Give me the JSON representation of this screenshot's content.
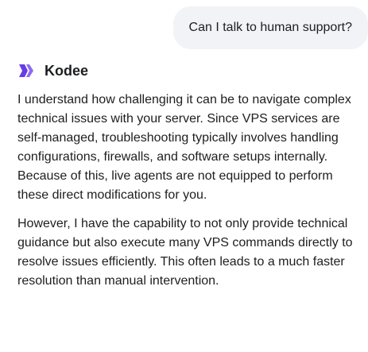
{
  "user_message": {
    "text": "Can I talk to human support?"
  },
  "assistant": {
    "name": "Kodee",
    "icon": "kodee-logo-icon",
    "brand_color": "#673de6",
    "paragraphs": [
      "I understand how challenging it can be to navigate complex technical issues with your server. Since VPS services are self-managed, troubleshooting typically involves handling configurations, firewalls, and software setups internally. Because of this, live agents are not equipped to perform these direct modifications for you.",
      "However, I have the capability to not only provide technical guidance but also execute many VPS commands directly to resolve issues efficiently. This often leads to a much faster resolution than manual intervention."
    ]
  },
  "colors": {
    "user_bubble_bg": "#f2f3f6",
    "text": "#1d1e20"
  }
}
